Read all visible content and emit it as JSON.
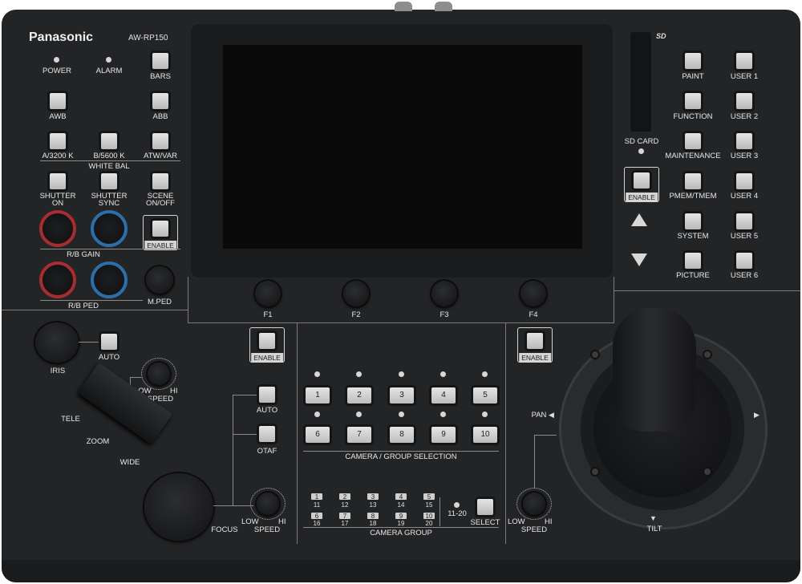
{
  "device": {
    "brand": "Panasonic",
    "model": "AW-RP150"
  },
  "left_section": {
    "power_label": "POWER",
    "alarm_label": "ALARM",
    "bars_label": "BARS",
    "awb_label": "AWB",
    "abb_label": "ABB",
    "a3200_label": "A/3200 K",
    "b5600_label": "B/5600 K",
    "white_bal_label": "WHITE BAL",
    "atw_var_label": "ATW/VAR",
    "shutter_on_label_1": "SHUTTER",
    "shutter_on_label_2": "ON",
    "shutter_sync_label_1": "SHUTTER",
    "shutter_sync_label_2": "SYNC",
    "scene_label_1": "SCENE",
    "scene_label_2": "ON/OFF",
    "enable_label": "ENABLE",
    "rb_gain_label": "R/B GAIN",
    "rb_ped_label": "R/B PED",
    "mped_label": "M.PED"
  },
  "right_section": {
    "sd_card_label": "SD CARD",
    "enable_label": "ENABLE",
    "menu_buttons": [
      "PAINT",
      "FUNCTION",
      "MAINTENANCE",
      "PMEM/TMEM",
      "SYSTEM",
      "PICTURE"
    ],
    "user_buttons": [
      "USER 1",
      "USER 2",
      "USER 3",
      "USER 4",
      "USER 5",
      "USER 6"
    ]
  },
  "function_keys": [
    "F1",
    "F2",
    "F3",
    "F4"
  ],
  "lens_section": {
    "iris_label": "IRIS",
    "auto_label": "AUTO",
    "low_label": "LOW",
    "hi_label": "HI",
    "speed_label": "SPEED",
    "tele_label": "TELE",
    "zoom_label": "ZOOM",
    "wide_label": "WIDE",
    "enable_label": "ENABLE",
    "focus_auto_label": "AUTO",
    "otaf_label": "OTAF",
    "focus_label": "FOCUS",
    "focus_low_label": "LOW",
    "focus_hi_label": "HI",
    "focus_speed_label": "SPEED"
  },
  "camera_selection": {
    "buttons": [
      "1",
      "2",
      "3",
      "4",
      "5",
      "6",
      "7",
      "8",
      "9",
      "10"
    ],
    "section_label": "CAMERA / GROUP SELECTION"
  },
  "camera_group": {
    "top_numbers": [
      "1",
      "2",
      "3",
      "4",
      "5",
      "6",
      "7",
      "8",
      "9",
      "10"
    ],
    "bottom_numbers": [
      "11",
      "12",
      "13",
      "14",
      "15",
      "16",
      "17",
      "18",
      "19",
      "20"
    ],
    "range_label": "11-20",
    "select_label": "SELECT",
    "section_label": "CAMERA GROUP"
  },
  "pan_tilt": {
    "enable_label": "ENABLE",
    "pan_label": "PAN",
    "tilt_label": "TILT",
    "low_label": "LOW",
    "hi_label": "HI",
    "speed_label": "SPEED"
  },
  "colors": {
    "body": "#232426",
    "gain_ring": "#a62c2f",
    "ped_ring": "#2d6ea8"
  }
}
